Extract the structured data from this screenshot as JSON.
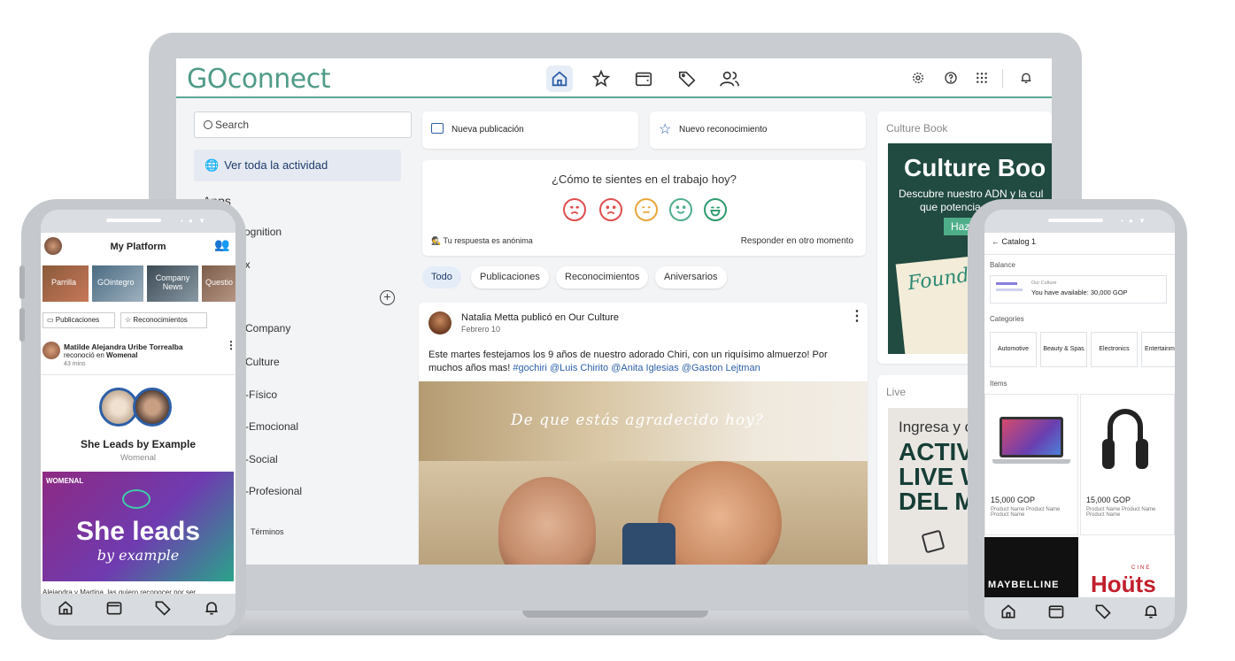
{
  "laptop": {
    "logo": "GOconnect",
    "search_placeholder": "Search",
    "ver_toda": "Ver toda la actividad",
    "sidebar": {
      "apps_heading": "Apps",
      "items": [
        "cognition",
        "ex",
        "s",
        "Company",
        "Culture",
        "-Físico",
        "-Emocional",
        "-Social",
        "-Profesional",
        "Términos"
      ]
    },
    "actions": {
      "new_post": "Nueva publicación",
      "new_recognition": "Nuevo reconocimiento"
    },
    "mood": {
      "question": "¿Cómo te sientes en el trabajo hoy?",
      "anonymous": "Tu respuesta es anónima",
      "later": "Responder en otro momento",
      "faces": [
        {
          "name": "very-sad",
          "color": "#e04e4e"
        },
        {
          "name": "sad",
          "color": "#e04e4e"
        },
        {
          "name": "neutral",
          "color": "#e8a63a"
        },
        {
          "name": "happy",
          "color": "#4fae8a"
        },
        {
          "name": "very-happy",
          "color": "#2e9b6f"
        }
      ]
    },
    "filters": [
      "Todo",
      "Publicaciones",
      "Reconocimientos",
      "Aniversarios"
    ],
    "post": {
      "author": "Natalia Metta",
      "verb": "publicó en",
      "group": "Our Culture",
      "date": "Febrero 10",
      "text": "Este martes festejamos los 9 años de nuestro adorado Chiri, con un riquísimo almuerzo! Por muchos años mas!",
      "tags": "#gochiri  @Luis Chirito @Anita Iglesias @Gaston Lejtman",
      "photo_caption": "De que estás agradecido hoy?"
    },
    "culture_book": {
      "heading": "Culture Book",
      "title": "Culture Boo",
      "subtitle1": "Descubre nuestro ADN y la cul",
      "subtitle2": "que potencia n",
      "button": "Haz",
      "script": "Founder"
    },
    "live": {
      "heading": "Live",
      "line1": "Ingresa y c",
      "line2": "ACTIVID",
      "line3": "LIVE WE",
      "line4": "DEL MES"
    }
  },
  "phone_left": {
    "title": "My Platform",
    "stories": [
      "Parrilla",
      "GOintegro",
      "Company News",
      "Questio"
    ],
    "tabs": [
      "Publicaciones",
      "Reconocimientos"
    ],
    "post": {
      "author": "Matilde Alejandra Uribe Torrealba",
      "action": "reconoció en",
      "group": "Womenal",
      "time": "43 mins",
      "award": "She Leads by Example",
      "award_group": "Womenal",
      "banner_label": "WOMENAL",
      "banner_title": "She leads",
      "banner_script": "by example",
      "caption": "Alejandra y Martina, las quiero reconocer por ser"
    }
  },
  "phone_right": {
    "back_title": "Catalog 1",
    "balance_heading": "Balance",
    "balance_source": "Our Culture",
    "balance_text": "You have available: 30,000 GOP",
    "categories_heading": "Categories",
    "categories": [
      "Automotive",
      "Beauty & Spas",
      "Electronics",
      "Entertainm"
    ],
    "items_heading": "Items",
    "items": [
      {
        "price": "15,000 GOP",
        "name": "Product Name Product Name Product Name"
      },
      {
        "price": "15,000 GOP",
        "name": "Product Name Product Name Product Name"
      }
    ],
    "brands": [
      "MAYBELLINE",
      "Hoüts"
    ],
    "brand_small": "CINE"
  }
}
